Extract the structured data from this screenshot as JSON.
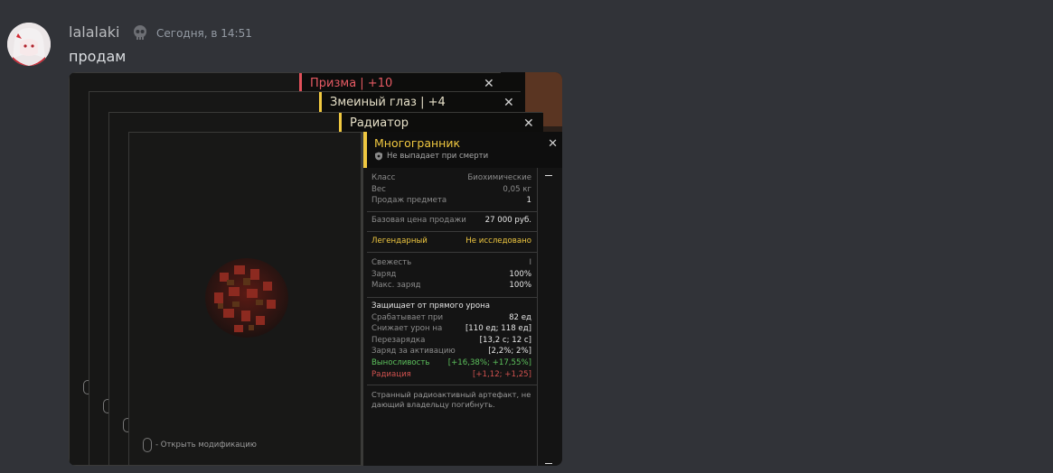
{
  "message": {
    "username": "lalalaki",
    "timestamp": "Сегодня, в 14:51",
    "text": "продам"
  },
  "stacked_windows": [
    {
      "title": "Призма | +10",
      "accent": "#e0505a"
    },
    {
      "title": "Змеиный глаз | +4",
      "accent": "#f0c840"
    },
    {
      "title": "Радиатор",
      "accent": "#f0c840"
    }
  ],
  "item": {
    "title": "Многогранник",
    "subtitle": "Не выпадает при смерти",
    "open_mod_hint": "- Открыть модификацию",
    "info": [
      {
        "label": "Класс",
        "value": "Биохимические"
      },
      {
        "label": "Вес",
        "value": "0,05 кг"
      },
      {
        "label": "Продаж предмета",
        "value": "1"
      }
    ],
    "price": {
      "label": "Базовая цена продажи",
      "value": "27 000 руб."
    },
    "rarity": {
      "label": "Легендарный",
      "value": "Не исследовано"
    },
    "state": [
      {
        "label": "Свежесть",
        "value": "I"
      },
      {
        "label": "Заряд",
        "value": "100%"
      },
      {
        "label": "Макс. заряд",
        "value": "100%"
      }
    ],
    "effects_title": "Защищает от прямого урона",
    "effects": [
      {
        "label": "Срабатывает при",
        "value": "82 ед"
      },
      {
        "label": "Снижает урон на",
        "value": "[110 ед; 118 ед]"
      },
      {
        "label": "Перезарядка",
        "value": "[13,2 с; 12 с]"
      },
      {
        "label": "Заряд за активацию",
        "value": "[2,2%; 2%]"
      },
      {
        "label": "Выносливость",
        "value": "[+16,38%; +17,55%]"
      },
      {
        "label": "Радиация",
        "value": "[+1,12; +1,25]"
      }
    ],
    "description": "Странный радиоактивный артефакт, не дающий владельцу погибнуть."
  },
  "colors": {
    "accent_yellow": "#f0c840",
    "red": "#e0505a",
    "green": "#5cc15c",
    "rad_red": "#d2524f"
  }
}
